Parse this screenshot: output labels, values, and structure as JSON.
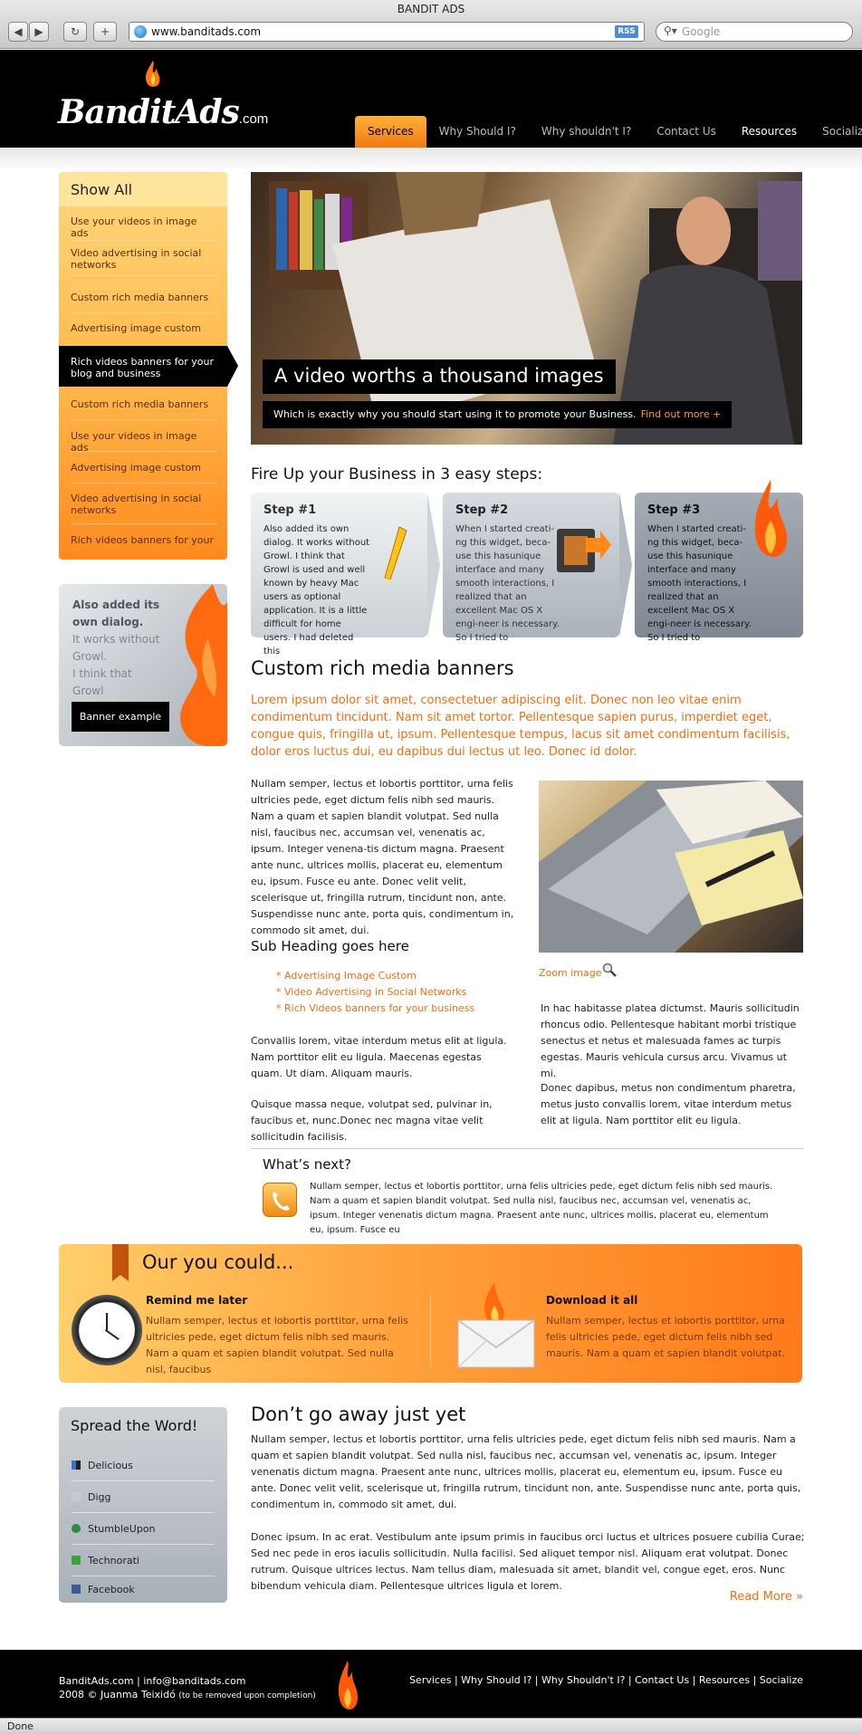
{
  "browser": {
    "window_title": "BANDIT ADS",
    "url": "www.banditads.com",
    "rss_label": "RSS",
    "search_placeholder": "Google",
    "status": "Done"
  },
  "site": {
    "logo_main": "BanditAds",
    "logo_domain": ".com",
    "nav": [
      "Services",
      "Why Should I?",
      "Why shouldn't I?",
      "Contact Us",
      "Resources",
      "Socialize"
    ],
    "active_nav": "Services"
  },
  "sidebar": {
    "show_all": "Show All",
    "items": [
      "Use your videos in image ads",
      "Video advertising in social networks",
      "Custom rich media banners",
      "Advertising image custom",
      "Rich videos banners for your blog and business",
      "Custom rich media banners",
      "Use your videos in image ads",
      "Advertising image custom",
      "Video advertising in social networks",
      "Rich videos banners for your"
    ],
    "selected_index": 4,
    "banner_lines": [
      "Also added its",
      "own dialog.",
      "It works without",
      "Growl.",
      "I think that Growl"
    ],
    "banner_button": "Banner example"
  },
  "hero": {
    "title": "A video worths a thousand images",
    "caption": "Which is exactly why you should start using it to promote your Business.",
    "link": "Find out more +"
  },
  "steps": {
    "title": "Fire Up your Business in 3 easy steps:",
    "items": [
      {
        "title": "Step #1",
        "text": "Also added its own dialog. It works without Growl. I think that Growl is used and well known by heavy Mac users as optional application. It is a little difficult for home users. I had deleted this"
      },
      {
        "title": "Step #2",
        "text": "When I started creati-ng this widget, beca-use this hasunique interface and many smooth interactions, I realized that an excellent Mac OS X engi-neer is necessary. So I tried to"
      },
      {
        "title": "Step #3",
        "text": "When I started creati-ng this widget, beca-use this hasunique interface and many smooth interactions, I realized that an excellent Mac OS X engi-neer is necessary. So I tried to"
      }
    ]
  },
  "content": {
    "title": "Custom rich media banners",
    "lead": "Lorem ipsum dolor sit amet, consectetuer adipiscing elit. Donec non leo vitae enim condimentum tincidunt. Nam sit amet tortor. Pellentesque sapien purus, imperdiet eget, congue quis, fringilla ut, ipsum. Pellentesque tempus, lacus sit amet condimentum facilisis, dolor eros luctus dui, eu dapibus dui lectus ut leo. Donec id dolor.",
    "body1": "Nullam semper, lectus et lobortis porttitor, urna felis ultricies pede, eget dictum felis nibh sed mauris. Nam a quam et sapien blandit volutpat. Sed nulla nisl, faucibus nec, accumsan vel, venenatis ac, ipsum. Integer venena-tis dictum magna. Praesent ante nunc, ultrices mollis, placerat eu, elementum eu, ipsum. Fusce eu ante. Donec velit velit, scelerisque ut, fringilla rutrum, tincidunt non, ante. Suspendisse nunc ante, porta quis, condimentum in, commodo sit amet, dui.",
    "subheading": "Sub Heading goes here",
    "list": [
      "Advertising Image Custom",
      "Video Advertising in Social Networks",
      "Rich Videos banners for your business"
    ],
    "body2": "Convallis lorem, vitae interdum metus elit at ligula. Nam porttitor elit eu ligula. Maecenas egestas quam. Ut diam. Aliquam mauris.",
    "body3": "Quisque massa neque, volutpat sed, pulvinar in, faucibus et, nunc.Donec nec magna vitae velit sollicitudin facilisis.",
    "zoom": "Zoom image",
    "body4": "In hac habitasse platea dictumst. Mauris sollicitudin rhoncus odio. Pellentesque habitant morbi tristique senectus et netus et malesuada fames ac turpis egestas. Mauris vehicula cursus arcu. Vivamus ut mi.",
    "body5": "Donec dapibus, metus non condimentum pharetra, metus justo convallis lorem, vitae interdum metus elit at ligula. Nam porttitor elit eu ligula.",
    "next_title": "What’s next?",
    "next_text": "Nullam semper, lectus et lobortis porttitor, urna felis ultricies pede, eget dictum felis nibh sed mauris. Nam a quam et sapien blandit volutpat. Sed nulla nisl, faucibus nec, accumsan vel, venenatis ac, ipsum. Integer venenatis dictum magna. Praesent ante nunc, ultrices mollis, placerat eu, elementum eu, ipsum. Fusce eu"
  },
  "band": {
    "title": "Our you could...",
    "left_title": "Remind me later",
    "left_text": "Nullam semper, lectus et lobortis porttitor, urna felis ultricies pede, eget dictum felis nibh sed mauris. Nam a quam et sapien blandit volutpat. Sed nulla nisl, faucibus",
    "right_title": "Download it all",
    "right_text": "Nullam semper, lectus et lobortis porttitor, urna felis ultricies pede, eget dictum felis nibh sed mauris. Nam a quam et sapien blandit volutpat."
  },
  "spread": {
    "title": "Spread the Word!",
    "items": [
      "Delicious",
      "Digg",
      "StumbleUpon",
      "Technorati",
      "Facebook"
    ]
  },
  "dont": {
    "title": "Don’t go away just yet",
    "p1": "Nullam semper, lectus et lobortis porttitor, urna felis ultricies pede, eget dictum felis nibh sed mauris. Nam a quam et sapien blandit volutpat. Sed nulla nisl, faucibus nec, accumsan vel, venenatis ac, ipsum. Integer venenatis dictum magna. Praesent ante nunc, ultrices mollis, placerat eu, elementum eu, ipsum. Fusce eu ante. Donec velit velit, scelerisque ut, fringilla rutrum, tincidunt non, ante. Suspendisse nunc ante, porta quis, condimentum in, commodo sit amet, dui.",
    "p2": "Donec ipsum. In ac erat. Vestibulum ante ipsum primis in faucibus orci luctus et ultrices posuere cubilia Curae; Sed nec pede in eros iaculis sollicitudin. Nulla facilisi. Sed aliquet tempor nisl. Aliquam erat volutpat. Donec rutrum. Quisque ultrices lectus. Nam tellus diam, malesuada sit amet, blandit vel, congue eget, eros. Nunc bibendum vehicula diam. Pellentesque ultrices ligula et lorem.",
    "read_more": "Read More »"
  },
  "footer": {
    "line1": "BanditAds.com  |  info@banditads.com",
    "line2": "2008 © Juanma Teixidó",
    "line2_small": "(to be removed upon completion)",
    "nav": "Services |  Why Should I?  |  Why Shouldn't I?  |  Contact Us  |  Resources  | Socialize"
  },
  "colors": {
    "accent": "#f06d10",
    "orange_light": "#ffd77c",
    "header_bg": "#000000",
    "gray_panel": "#b8bec4"
  }
}
